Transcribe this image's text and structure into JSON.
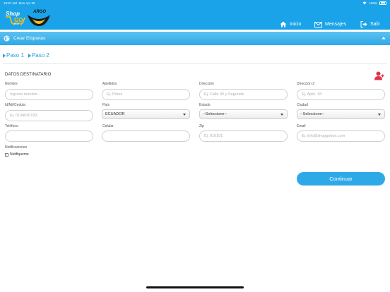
{
  "status_bar": {
    "time": "10:57 AM",
    "date": "Mon Apr 25",
    "battery": "100%"
  },
  "header": {
    "logo_shop": {
      "word1": "Shop",
      "word2": "GO",
      "word3": "BOX"
    },
    "logo_partner": "ARGO",
    "nav": [
      {
        "label": "Inicio",
        "icon": "home-icon"
      },
      {
        "label": "Mensajes",
        "icon": "envelope-icon"
      },
      {
        "label": "Salir",
        "icon": "sign-out-icon"
      }
    ]
  },
  "section_bar": {
    "title": "Crear Etiquetas"
  },
  "steps": [
    {
      "label": "Paso 1"
    },
    {
      "label": "Paso 2"
    }
  ],
  "form": {
    "section_title": "DATOS DESTINATARIO",
    "fields": {
      "nombre": {
        "label": "Nombre",
        "placeholder": "Ingrese nombre..."
      },
      "apellidos": {
        "label": "Apellidos",
        "placeholder": "Ej. Pérez"
      },
      "direccion": {
        "label": "Dirección",
        "placeholder": "Ej. Calle 45 y Segunda"
      },
      "direccion2": {
        "label": "Dirección 2",
        "placeholder": "Ej. Apto. 18"
      },
      "id": {
        "label": "Id/Nit/Cedula",
        "placeholder": "Ej. 0104030193"
      },
      "pais": {
        "label": "País",
        "value": "ECUADOR"
      },
      "estado": {
        "label": "Estado",
        "value": "--Seleccione--"
      },
      "ciudad": {
        "label": "Ciudad",
        "value": "--Seleccione--"
      },
      "telefono": {
        "label": "Teléfono",
        "placeholder": ""
      },
      "celular": {
        "label": "Celular",
        "placeholder": ""
      },
      "zip": {
        "label": "Zip",
        "placeholder": "Ej. 010101"
      },
      "email": {
        "label": "Email",
        "placeholder": "Ej. info@shopgobox.com"
      }
    },
    "notifications": {
      "label": "Notificaciones",
      "checkbox_label": "Notifiqueme",
      "checked": false
    },
    "continue_label": "Continuar"
  },
  "colors": {
    "brand_blue": "#1aa3e8",
    "button_blue": "#2ea9e8",
    "add_user_red": "#e0334a"
  }
}
